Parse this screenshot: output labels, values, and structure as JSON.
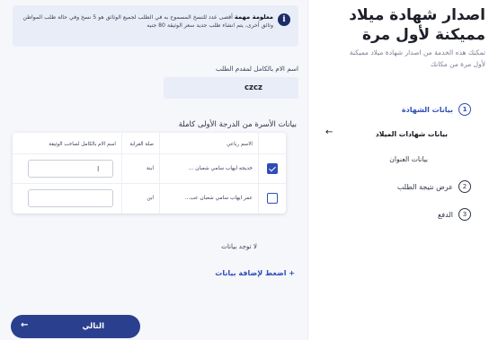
{
  "sidebar": {
    "title_line1": "اصدار شهادة ميلاد",
    "title_line2": "مميكنة لأول مرة",
    "subtitle_line1": "تمكنك هذه الخدمة من اصدار شهادة ميلاد مميكنة",
    "subtitle_line2": "لأول مرة من مكانك",
    "steps": [
      {
        "num": "1",
        "label": "بيانات الشهادة",
        "active": true
      },
      {
        "num": "2",
        "label": "عرض نتيجة الطلب"
      },
      {
        "num": "3",
        "label": "الدفع"
      }
    ],
    "sub_steps": [
      {
        "label": "بيانات شهادات الميلاد",
        "current": true
      },
      {
        "label": "بيانات العنوان"
      }
    ]
  },
  "notice": {
    "icon": "i",
    "heading": "معلومة مهمة",
    "text": "أقصى عدد للنسخ المسموح به في الطلب لجميع الوثائق هو 5 نسخ وفي حالة طلب المواطن وثائق أخرى، يتم انشاء طلب جديد سعر الوثيقة 80 جنيه"
  },
  "applicant": {
    "label": "اسم الام بالكامل لمقدم الطلب",
    "value": "czcz"
  },
  "family_section": {
    "title": "بيانات الأسرة من الدرجة الأولى كاملة",
    "columns": [
      "الاسم رباعي",
      "صلة القرابة",
      "اسم الام بالكامل لصاحب الوثيقة"
    ],
    "rows": [
      {
        "name": "خديجه ايهاب سامي شعبان ...",
        "relation": "ابنة",
        "mother": "",
        "checked": true
      },
      {
        "name": "عمر ايهاب سامي شعبان عب...",
        "relation": "ابن",
        "mother": "",
        "checked": false
      }
    ]
  },
  "no_data_text": "لا توجد بيانات",
  "add_link": "+ اضغط لإضافة بيانات",
  "next_button": {
    "label": "التالي",
    "arrow": "←"
  },
  "back_arrow": "←",
  "colors": {
    "accent": "#2f4db8",
    "button": "#2b3f8f",
    "notice_bg": "#e9edf8"
  }
}
